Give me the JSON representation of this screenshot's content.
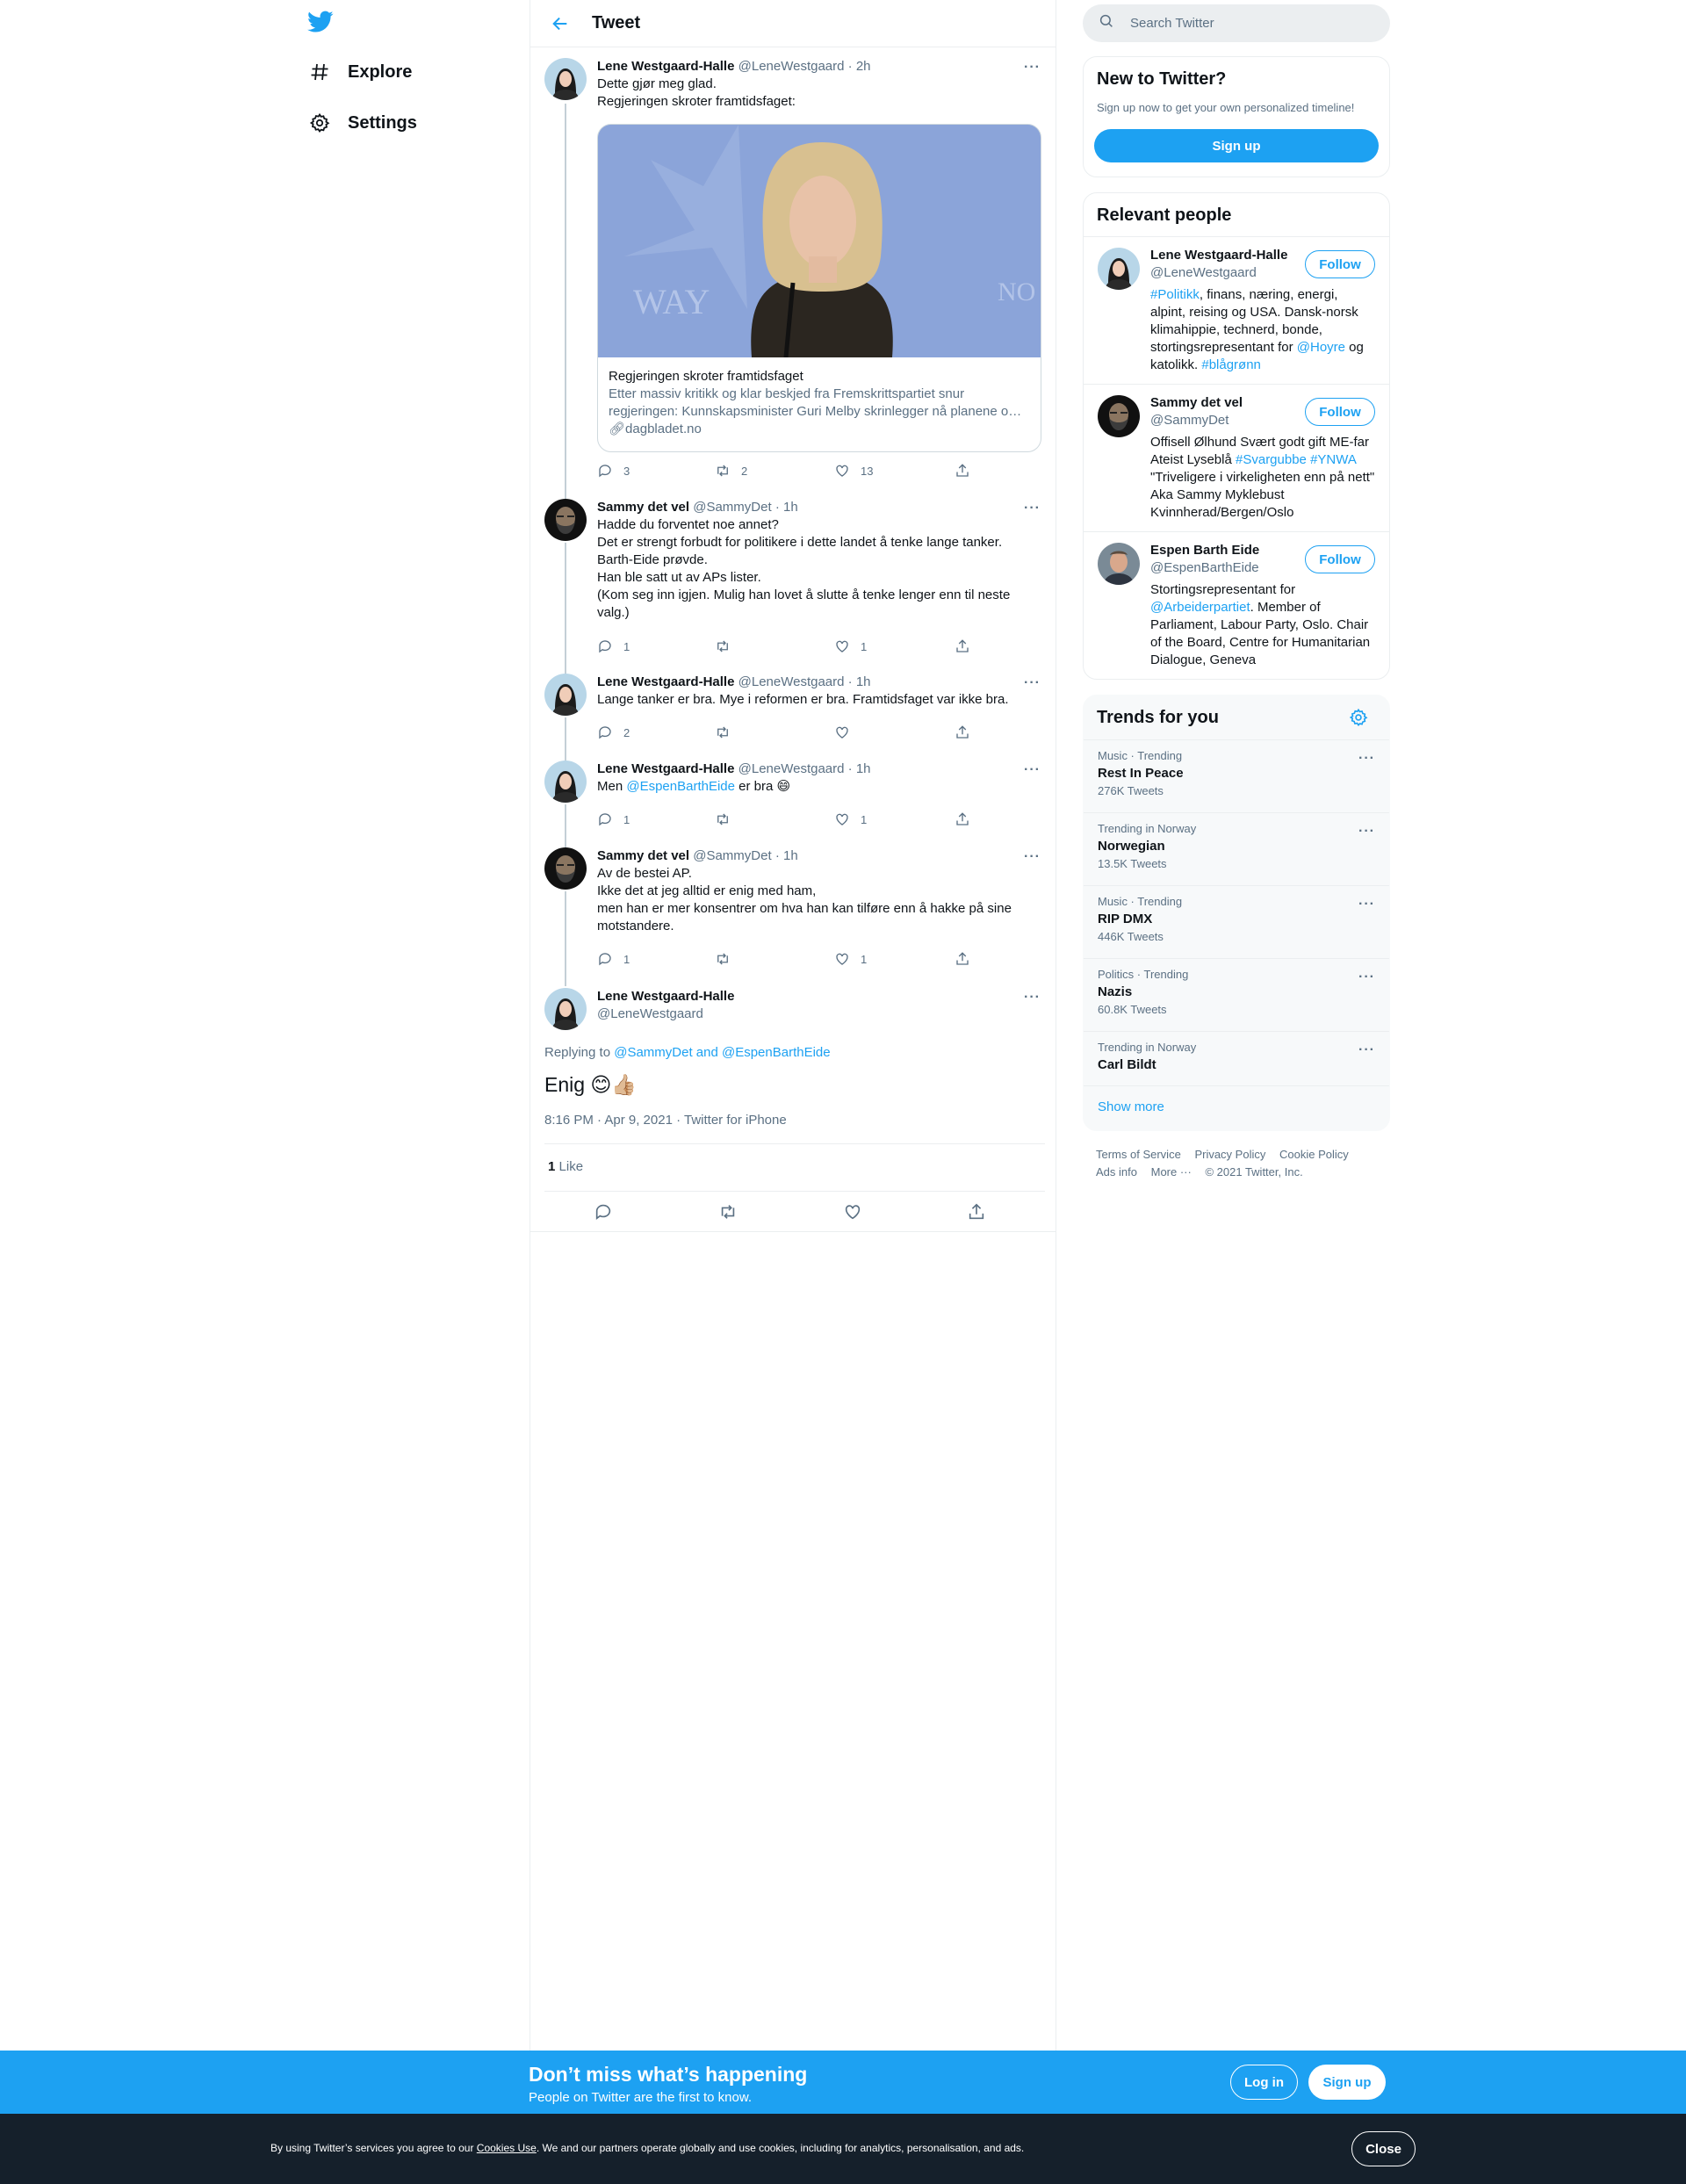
{
  "nav": {
    "items": [
      {
        "label": "Explore",
        "icon": "hashtag-icon"
      },
      {
        "label": "Settings",
        "icon": "gear-icon"
      }
    ]
  },
  "header": {
    "title": "Tweet"
  },
  "thread": [
    {
      "name": "Lene Westgaard-Halle",
      "handle": "@LeneWestgaard",
      "time": "· 2h",
      "lines": [
        "Dette gjør meg glad.",
        "Regjeringen skroter framtidsfaget:"
      ],
      "card": {
        "title": "Regjeringen skroter framtidsfaget",
        "desc": "Etter massiv kritikk og klar beskjed fra Fremskrittspartiet snur regjeringen: Kunnskapsminister Guri Melby skrinlegger nå planene o…",
        "domain": "dagbladet.no"
      },
      "replies": "3",
      "retweets": "2",
      "likes": "13"
    },
    {
      "name": "Sammy det vel",
      "handle": "@SammyDet",
      "time": "· 1h",
      "lines": [
        "Hadde du forventet noe annet?",
        "Det er strengt forbudt for politikere i dette landet å tenke lange tanker.",
        "Barth-Eide prøvde.",
        "Han ble satt ut av APs lister.",
        "(Kom seg inn igjen. Mulig han lovet å slutte å tenke lenger enn til neste",
        "valg.)"
      ],
      "replies": "1",
      "retweets": "",
      "likes": "1"
    },
    {
      "name": "Lene Westgaard-Halle",
      "handle": "@LeneWestgaard",
      "time": "· 1h",
      "lines": [
        "Lange tanker er bra. Mye i reformen er bra. Framtidsfaget var ikke bra."
      ],
      "replies": "2",
      "retweets": "",
      "likes": ""
    },
    {
      "name": "Lene Westgaard-Halle",
      "handle": "@LeneWestgaard",
      "time": "· 1h",
      "text_pre": "Men ",
      "mention": "@EspenBarthEide",
      "text_post": " er bra 😄",
      "replies": "1",
      "retweets": "",
      "likes": "1"
    },
    {
      "name": "Sammy det vel",
      "handle": "@SammyDet",
      "time": "· 1h",
      "lines": [
        "Av de bestei AP.",
        "Ikke det at jeg alltid er enig med ham,",
        "men han er mer konsentrer om hva han kan tilføre enn å hakke på sine",
        "motstandere."
      ],
      "replies": "1",
      "retweets": "",
      "likes": "1"
    }
  ],
  "main_tweet": {
    "name": "Lene Westgaard-Halle",
    "handle": "@LeneWestgaard",
    "replying_label": "Replying to ",
    "replying_to": "@SammyDet and @EspenBarthEide",
    "text": "Enig 😊👍🏼",
    "timestamp": "8:16 PM · Apr 9, 2021 · Twitter for iPhone",
    "like_count": "1",
    "like_label": "Like"
  },
  "search": {
    "placeholder": "Search Twitter"
  },
  "new_to_twitter": {
    "title": "New to Twitter?",
    "subtitle": "Sign up now to get your own personalized timeline!",
    "button": "Sign up"
  },
  "relevant": {
    "title": "Relevant people",
    "follow_label": "Follow",
    "people": [
      {
        "name": "Lene Westgaard-Halle",
        "handle": "@LeneWestgaard"
      },
      {
        "name": "Sammy det vel",
        "handle": "@SammyDet"
      },
      {
        "name": "Espen Barth Eide",
        "handle": "@EspenBarthEide"
      }
    ],
    "bio1": {
      "l1_tag": "#Politikk",
      "l1_rest": ", finans, næring, energi,",
      "l2": "alpint, reising og USA. Dansk-norsk",
      "l3": "klimahippie, technerd, bonde,",
      "l4_pre": "stortingsrepresentant for ",
      "l4_tag": "@Hoyre",
      "l4_post": " og",
      "l5_pre": "katolikk. ",
      "l5_tag": "#blågrønn"
    },
    "bio2": {
      "l1": "Offisell Ølhund Svært godt gift ME-far",
      "l2_pre": "Ateist Lyseblå ",
      "l2_tag1": "#Svargubbe",
      "l2_tag2": "#YNWA",
      "l3": "\"Triveligere i virkeligheten enn på nett\"",
      "l4": "Aka Sammy Myklebust",
      "l5": "Kvinnherad/Bergen/Oslo"
    },
    "bio3": {
      "l1": "Stortingsrepresentant for",
      "l2_tag": "@Arbeiderpartiet",
      "l2_rest": ". Member of",
      "l3": "Parliament, Labour Party, Oslo. Chair",
      "l4": "of the Board, Centre for Humanitarian",
      "l5": "Dialogue, Geneva"
    }
  },
  "trends": {
    "title": "Trends for you",
    "items": [
      {
        "context": "Music · Trending",
        "name": "Rest In Peace",
        "count": "276K Tweets"
      },
      {
        "context": "Trending in Norway",
        "name": "Norwegian",
        "count": "13.5K Tweets"
      },
      {
        "context": "Music · Trending",
        "name": "RIP DMX",
        "count": "446K Tweets"
      },
      {
        "context": "Politics · Trending",
        "name": "Nazis",
        "count": "60.8K Tweets"
      },
      {
        "context": "Trending in Norway",
        "name": "Carl Bildt",
        "count": ""
      }
    ],
    "show_more": "Show more"
  },
  "footer": {
    "links": [
      "Terms of Service",
      "Privacy Policy",
      "Cookie Policy",
      "Ads info",
      "More ···",
      "© 2021 Twitter, Inc."
    ]
  },
  "promo": {
    "headline": "Don’t miss what’s happening",
    "sub": "People on Twitter are the first to know.",
    "login": "Log in",
    "signup": "Sign up"
  },
  "cookie": {
    "pre": "By using Twitter’s services you agree to our ",
    "link": "Cookies Use",
    "post": ". We and our partners operate globally and use cookies, including for analytics, personalisation, and ads.",
    "close": "Close"
  },
  "colors": {
    "accent": "#1da1f2",
    "text": "#0f1419",
    "muted": "#5b7083",
    "banner_dark": "#15202b"
  }
}
